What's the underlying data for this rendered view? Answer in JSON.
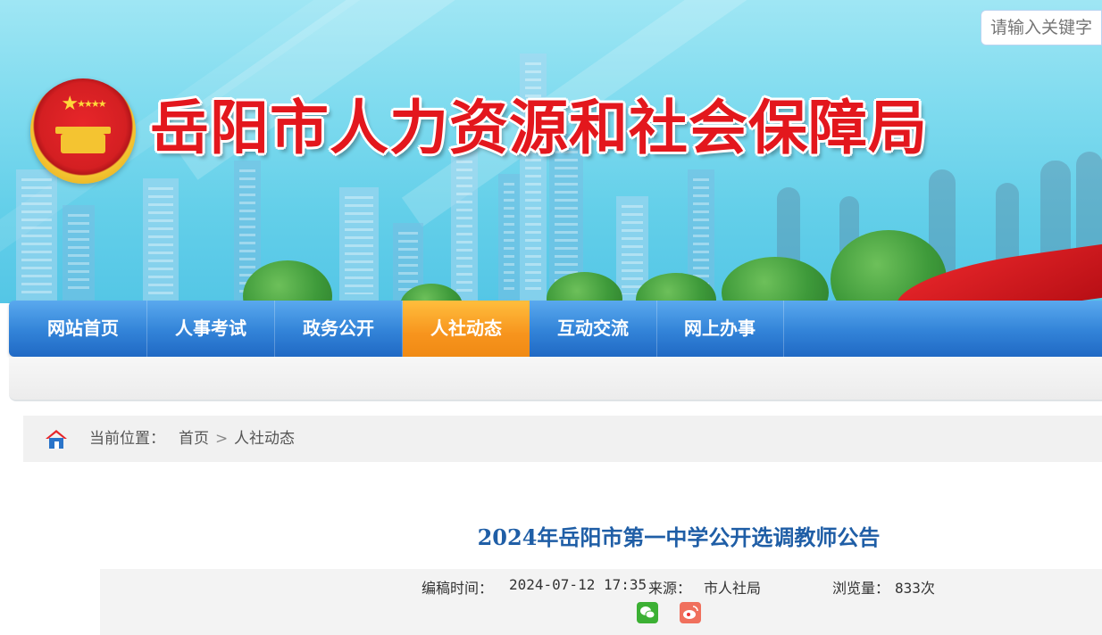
{
  "header": {
    "site_title": "岳阳市人力资源和社会保障局"
  },
  "nav": {
    "items": [
      "网站首页",
      "人事考试",
      "政务公开",
      "人社动态",
      "互动交流",
      "网上办事"
    ],
    "active": "人社动态"
  },
  "search": {
    "placeholder": "请输入关键字"
  },
  "breadcrumb": {
    "label": "当前位置：",
    "items": [
      "首页",
      "人社动态"
    ],
    "separator": ">"
  },
  "article": {
    "title": "2024年岳阳市第一中学公开选调教师公告",
    "meta": {
      "time_label": "编稿时间：",
      "time_value": "2024-07-12 17:35",
      "source_label": "来源：",
      "source_value": "市人社局",
      "views_label": "浏览量：",
      "views_value": "833次"
    },
    "share": [
      "wechat-icon",
      "weibo-icon"
    ]
  },
  "colors": {
    "nav_blue": "#3283d8",
    "nav_active": "#f7941d",
    "title_red": "#e3171d",
    "article_title": "#1f5ea6"
  }
}
